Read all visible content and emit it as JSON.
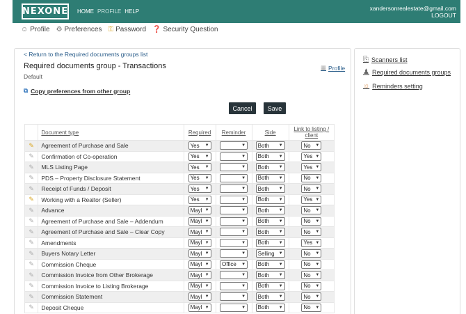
{
  "header": {
    "logo": "NEXONE",
    "nav": [
      "HOME",
      "PROFILE",
      "HELP"
    ],
    "user_email": "xandersonrealestate@gmail.com",
    "logout": "LOGOUT"
  },
  "subnav": [
    {
      "label": "Profile",
      "icon": "user-icon"
    },
    {
      "label": "Preferences",
      "icon": "gear-icon"
    },
    {
      "label": "Password",
      "icon": "key-icon"
    },
    {
      "label": "Security Question",
      "icon": "question-icon"
    }
  ],
  "page": {
    "back_link": "< Return to the Required documents groups list",
    "title": "Required documents group - Transactions",
    "subtitle": "Default",
    "profile_link": "Profile",
    "copy_link": "Copy preferences from other group",
    "cancel": "Cancel",
    "save": "Save"
  },
  "table": {
    "headers": [
      "Document type",
      "Required",
      "Reminder",
      "Side",
      "Link to listing / client"
    ],
    "rows": [
      {
        "doc": "Agreement of Purchase and Sale",
        "required": "Yes",
        "reminder": "",
        "side": "Both",
        "link": "No",
        "icon": "pencil-icon-active"
      },
      {
        "doc": "Confirmation of Co-operation",
        "required": "Yes",
        "reminder": "",
        "side": "Both",
        "link": "Yes",
        "icon": "pencil-icon"
      },
      {
        "doc": "MLS Listing Page",
        "required": "Yes",
        "reminder": "",
        "side": "Both",
        "link": "Yes",
        "icon": "pencil-icon"
      },
      {
        "doc": "PDS – Property Disclosure Statement",
        "required": "Yes",
        "reminder": "",
        "side": "Both",
        "link": "No",
        "icon": "pencil-icon"
      },
      {
        "doc": "Receipt of Funds / Deposit",
        "required": "Yes",
        "reminder": "",
        "side": "Both",
        "link": "No",
        "icon": "pencil-icon"
      },
      {
        "doc": "Working with a Realtor (Seller)",
        "required": "Yes",
        "reminder": "",
        "side": "Both",
        "link": "Yes",
        "icon": "pencil-icon-active"
      },
      {
        "doc": "Advance",
        "required": "Mayl",
        "reminder": "",
        "side": "Both",
        "link": "No",
        "icon": "pencil-icon"
      },
      {
        "doc": "Agreement of Purchase and Sale – Addendum",
        "required": "Mayl",
        "reminder": "",
        "side": "Both",
        "link": "No",
        "icon": "pencil-icon"
      },
      {
        "doc": "Agreement of Purchase and Sale – Clear Copy",
        "required": "Mayl",
        "reminder": "",
        "side": "Both",
        "link": "No",
        "icon": "pencil-icon"
      },
      {
        "doc": "Amendments",
        "required": "Mayl",
        "reminder": "",
        "side": "Both",
        "link": "Yes",
        "icon": "pencil-icon"
      },
      {
        "doc": "Buyers Notary Letter",
        "required": "Mayl",
        "reminder": "",
        "side": "Selling",
        "link": "No",
        "icon": "pencil-icon"
      },
      {
        "doc": "Commission Cheque",
        "required": "Mayl",
        "reminder": "Office",
        "side": "Both",
        "link": "No",
        "icon": "pencil-icon"
      },
      {
        "doc": "Commission Invoice from Other Brokerage",
        "required": "Mayl",
        "reminder": "",
        "side": "Both",
        "link": "No",
        "icon": "pencil-icon"
      },
      {
        "doc": "Commission Invoice to Listing Brokerage",
        "required": "Mayl",
        "reminder": "",
        "side": "Both",
        "link": "No",
        "icon": "pencil-icon"
      },
      {
        "doc": "Commission Statement",
        "required": "Mayl",
        "reminder": "",
        "side": "Both",
        "link": "No",
        "icon": "pencil-icon"
      },
      {
        "doc": "Deposit Cheque",
        "required": "Mayl",
        "reminder": "",
        "side": "Both",
        "link": "No",
        "icon": "pencil-icon"
      }
    ]
  },
  "sidebar": {
    "links": [
      {
        "label": "Scanners list",
        "icon": "scanner-icon"
      },
      {
        "label": "Required documents groups",
        "icon": "group-icon"
      },
      {
        "label": "Reminders setting",
        "icon": "reminder-icon"
      }
    ]
  },
  "colors": {
    "header_bg": "#2e7d74",
    "button_bg": "#28343a",
    "link": "#2a5d8a"
  }
}
